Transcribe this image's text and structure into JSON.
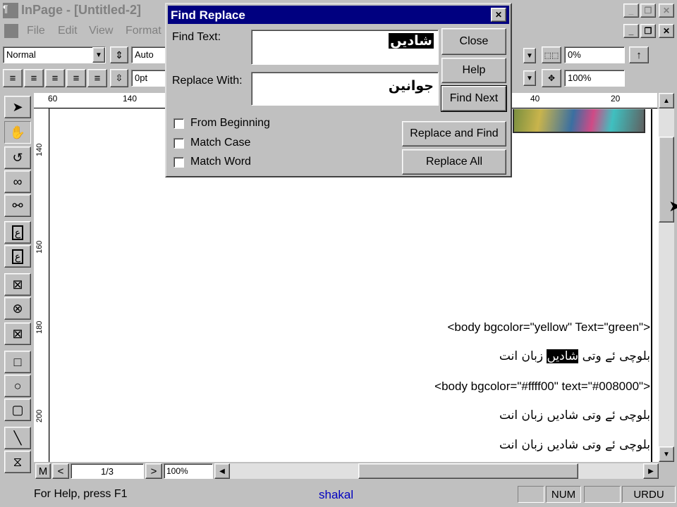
{
  "app": {
    "title": "InPage - [Untitled-2]",
    "menu": [
      "File",
      "Edit",
      "View",
      "Format"
    ]
  },
  "toolbar": {
    "style_value": "Normal",
    "leading_value": "Auto",
    "size_value": "0pt",
    "percent1": "0%",
    "percent2": "100%"
  },
  "ruler": {
    "labels": [
      "60",
      "140",
      "40",
      "20"
    ]
  },
  "vruler": {
    "labels": [
      "140",
      "160",
      "180",
      "200"
    ]
  },
  "dialog": {
    "title": "Find Replace",
    "find_label": "Find Text:",
    "find_value": "شادیں",
    "replace_label": "Replace With:",
    "replace_value": "جوانین",
    "close": "Close",
    "help": "Help",
    "find_next": "Find Next",
    "replace_and_find": "Replace and Find",
    "replace_all": "Replace All",
    "from_beginning": "From Beginning",
    "match_case": "Match Case",
    "match_word": "Match Word"
  },
  "document": {
    "line1": "<body bgcolor=\"yellow\" Text=\"green\">",
    "urdu1_before": "بلوچی ئے وتی",
    "urdu1_highlight": "شادیں",
    "urdu1_after": "زبان انت",
    "line2": "<body bgcolor=\"#ffff00\" text=\"#008000\">",
    "urdu2": "بلوچی ئے وتی شادیں زبان انت",
    "urdu3": "بلوچی ئے وتی شادیں زبان انت"
  },
  "nav": {
    "master": "M",
    "prev": "<",
    "page": "1/3",
    "next": ">",
    "zoom": "100%"
  },
  "status": {
    "help": "For Help, press F1",
    "font": "shakal",
    "num": "NUM",
    "lang": "URDU"
  },
  "colors": {
    "dialog_title_bg": "#000080",
    "status_font": "#0000c0"
  }
}
